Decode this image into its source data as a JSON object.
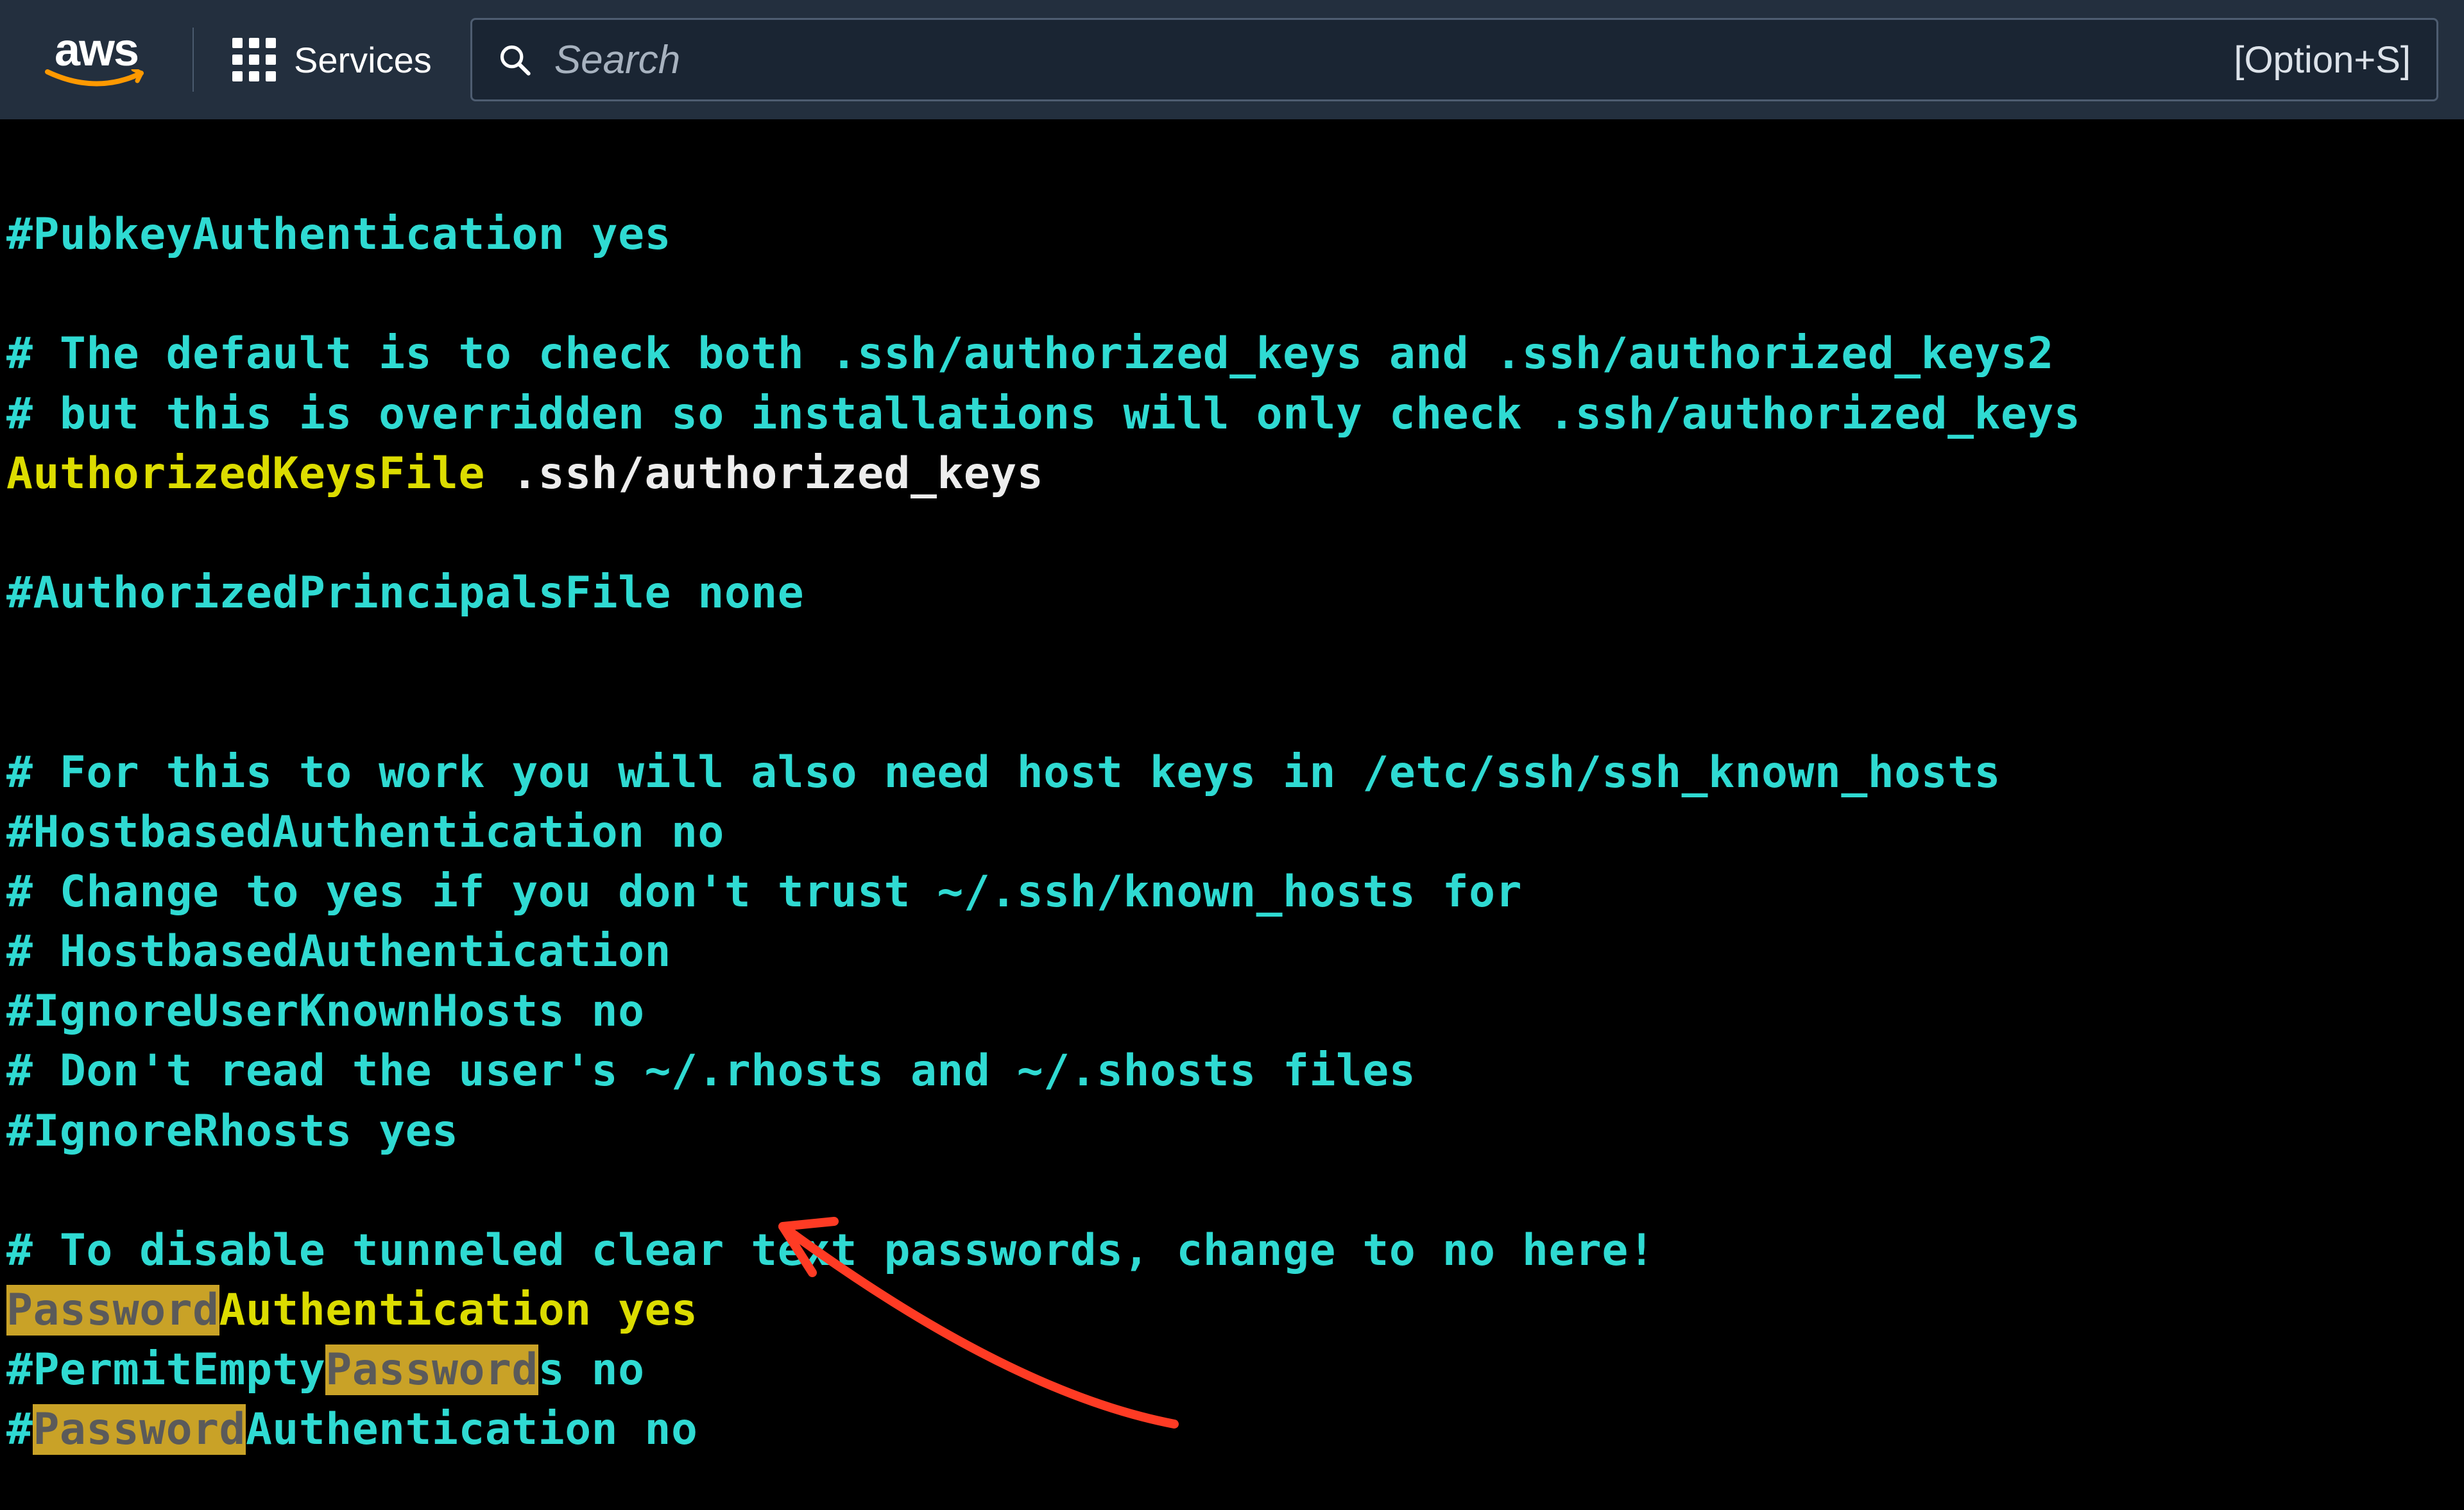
{
  "header": {
    "logo_text": "aws",
    "services_label": "Services",
    "search_placeholder": "Search",
    "search_shortcut": "[Option+S]"
  },
  "terminal": {
    "lines": {
      "l1": "#PubkeyAuthentication yes",
      "l2": "",
      "l3": "# The default is to check both .ssh/authorized_keys and .ssh/authorized_keys2",
      "l4": "# but this is overridden so installations will only check .ssh/authorized_keys",
      "l5a": "AuthorizedKeysFile",
      "l5b": " .ssh/authorized_keys",
      "l6": "",
      "l7": "#AuthorizedPrincipalsFile none",
      "l8": "",
      "l9": "",
      "l10": "# For this to work you will also need host keys in /etc/ssh/ssh_known_hosts",
      "l11": "#HostbasedAuthentication no",
      "l12": "# Change to yes if you don't trust ~/.ssh/known_hosts for",
      "l13": "# HostbasedAuthentication",
      "l14": "#IgnoreUserKnownHosts no",
      "l15": "# Don't read the user's ~/.rhosts and ~/.shosts files",
      "l16": "#IgnoreRhosts yes",
      "l17": "",
      "l18": "# To disable tunneled clear text passwords, change to no here!",
      "l19a": "Password",
      "l19b": "Authentication yes",
      "l20a": "#PermitEmpty",
      "l20b": "Password",
      "l20c": "s no",
      "l21a": "#",
      "l21b": "Password",
      "l21c": "Authentication no"
    },
    "highlight_term": "Password",
    "annotation": "arrow pointing to PasswordAuthentication yes"
  }
}
